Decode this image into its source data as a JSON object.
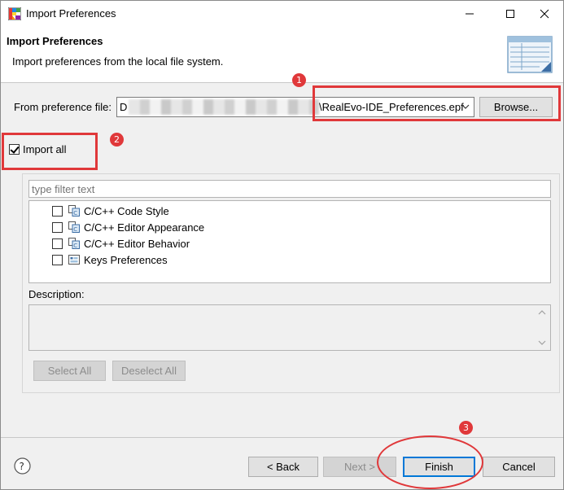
{
  "window": {
    "title": "Import Preferences",
    "accent_color": "#0078d7"
  },
  "header": {
    "title": "Import Preferences",
    "description": "Import preferences from the local file system."
  },
  "file_row": {
    "label": "From preference file:",
    "path_prefix": "D",
    "file_name": "\\RealEvo-IDE_Preferences.epf",
    "browse_label": "Browse..."
  },
  "import_all": {
    "label": "Import all",
    "checked": true
  },
  "filter": {
    "placeholder": "type filter text"
  },
  "tree": {
    "items": [
      {
        "label": "C/C++ Code Style",
        "icon": "preference-page-icon",
        "checked": false
      },
      {
        "label": "C/C++ Editor Appearance",
        "icon": "preference-page-icon",
        "checked": false
      },
      {
        "label": "C/C++ Editor Behavior",
        "icon": "preference-page-icon",
        "checked": false
      },
      {
        "label": "Keys Preferences",
        "icon": "keys-page-icon",
        "checked": false
      }
    ]
  },
  "description": {
    "label": "Description:",
    "text": ""
  },
  "selection_buttons": {
    "select_all": "Select All",
    "deselect_all": "Deselect All"
  },
  "footer": {
    "back_label": "< Back",
    "next_label": "Next >",
    "finish_label": "Finish",
    "cancel_label": "Cancel"
  },
  "annotations": {
    "color": "#e0383a",
    "badges": [
      "1",
      "2",
      "3"
    ]
  }
}
